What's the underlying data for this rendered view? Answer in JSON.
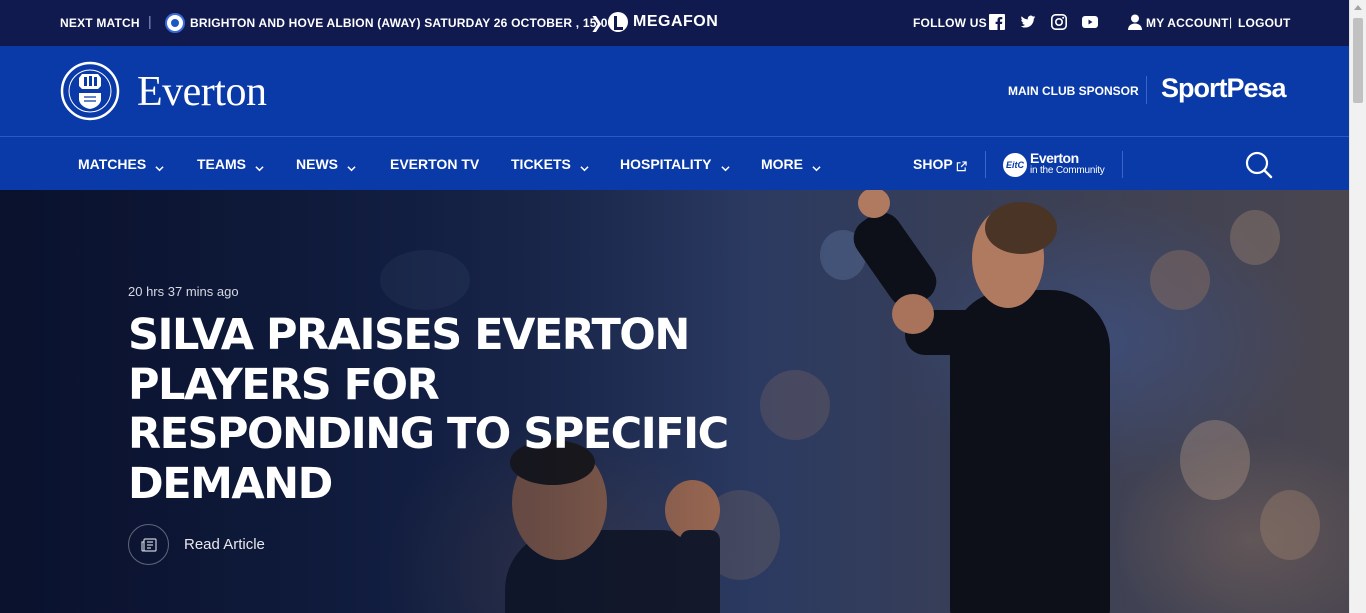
{
  "topbar": {
    "next_match_label": "NEXT MATCH",
    "separator": "|",
    "match_info": "BRIGHTON AND HOVE ALBION  (AWAY)  SATURDAY 26 OCTOBER , 15:00",
    "partner_name": "MEGAFON",
    "follow_label": "FOLLOW US",
    "social_icons": [
      "facebook-icon",
      "twitter-icon",
      "instagram-icon",
      "youtube-icon"
    ],
    "account_label": "MY ACCOUNT",
    "logout_separator": "|",
    "logout_label": "LOGOUT"
  },
  "header": {
    "club_name": "Everton",
    "sponsor_label": "MAIN CLUB SPONSOR",
    "sponsor_name": "SportPesa"
  },
  "nav": {
    "items": [
      {
        "label": "MATCHES",
        "has_dropdown": true
      },
      {
        "label": "TEAMS",
        "has_dropdown": true
      },
      {
        "label": "NEWS",
        "has_dropdown": true
      },
      {
        "label": "EVERTON TV",
        "has_dropdown": false
      },
      {
        "label": "TICKETS",
        "has_dropdown": true
      },
      {
        "label": "HOSPITALITY",
        "has_dropdown": true
      },
      {
        "label": "MORE",
        "has_dropdown": true
      }
    ],
    "shop_label": "SHOP",
    "community": {
      "badge": "EitC",
      "title": "Everton",
      "subtitle": "in the Community"
    }
  },
  "hero": {
    "timestamp": "20 hrs 37 mins ago",
    "headline": "SILVA PRAISES EVERTON PLAYERS FOR RESPONDING TO SPECIFIC DEMAND",
    "read_label": "Read Article"
  },
  "colors": {
    "topbar_bg": "#111a4e",
    "brand_blue": "#0a3aa8"
  }
}
